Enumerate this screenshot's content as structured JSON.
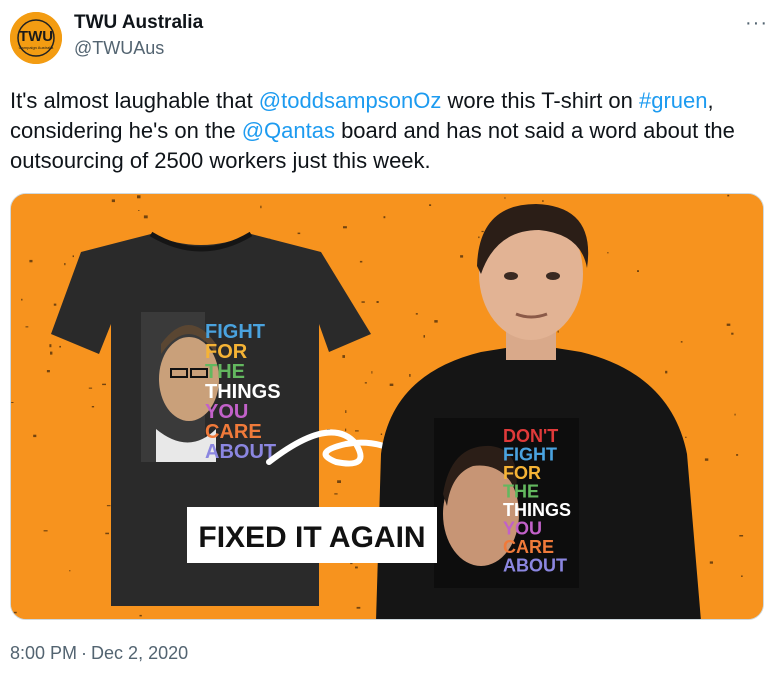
{
  "account": {
    "display_name": "TWU Australia",
    "handle": "@TWUAus",
    "avatar_text": "TWU",
    "avatar_subtext": "Campaign Australia"
  },
  "more_icon": "more-options-icon",
  "tweet": {
    "segments": [
      {
        "text": "It's almost laughable that ",
        "link": false
      },
      {
        "text": "@toddsampsonOz",
        "link": true
      },
      {
        "text": " wore this T-shirt on ",
        "link": false
      },
      {
        "text": "#gruen",
        "link": true
      },
      {
        "text": ", considering he's on the ",
        "link": false
      },
      {
        "text": "@Qantas",
        "link": true
      },
      {
        "text": " board and has not said a word about the outsourcing of 2500 workers just this week.",
        "link": false
      }
    ]
  },
  "image": {
    "left_shirt_words": [
      "FIGHT",
      "FOR",
      "THE",
      "THINGS",
      "YOU",
      "CARE",
      "ABOUT"
    ],
    "right_shirt_words": [
      "DON'T",
      "FIGHT",
      "FOR",
      "THE",
      "THINGS",
      "YOU",
      "CARE",
      "ABOUT"
    ],
    "banner": "FIXED IT AGAIN",
    "background_color": "#f7931e",
    "word_colors": [
      "#e03a3a",
      "#4aa3df",
      "#f5b335",
      "#63b85f",
      "#ffffff",
      "#c261c9",
      "#f07a3a",
      "#8b86e0"
    ]
  },
  "meta": {
    "time": "8:00 PM",
    "separator": "·",
    "date": "Dec 2, 2020"
  }
}
